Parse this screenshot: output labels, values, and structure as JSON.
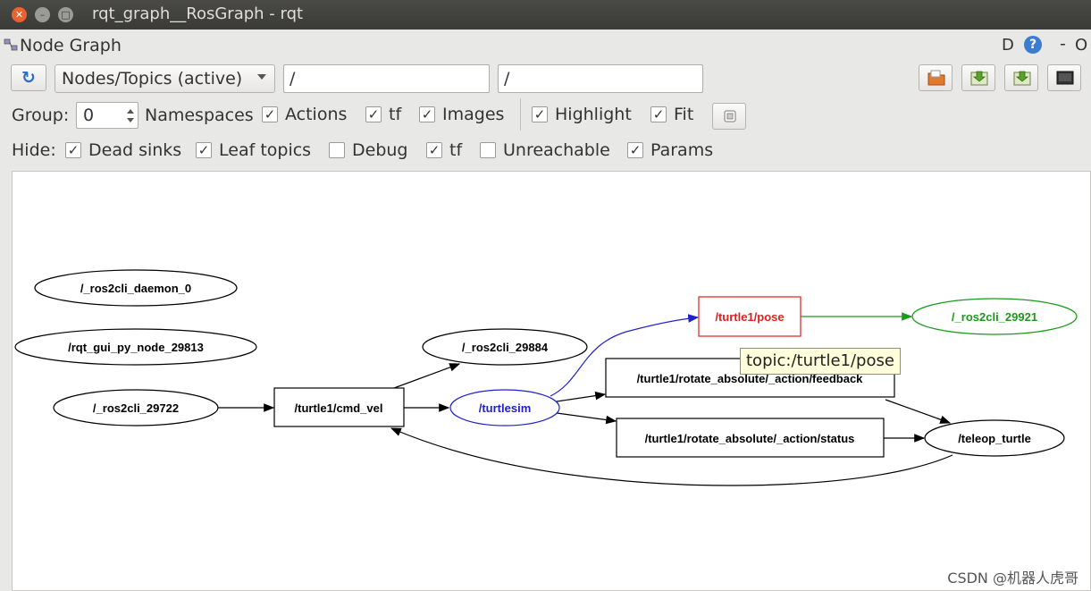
{
  "window": {
    "title": "rqt_graph__RosGraph - rqt"
  },
  "panel": {
    "title": "Node Graph",
    "d_label": "D",
    "help_icon": "?",
    "minimize": "-",
    "close": "O"
  },
  "toolbar": {
    "mode_select": "Nodes/Topics (active)",
    "filter_1": "/",
    "filter_2": "/"
  },
  "row_group": {
    "group_label": "Group:",
    "group_value": "0",
    "namespaces": "Namespaces",
    "actions": "Actions",
    "tf": "tf",
    "images": "Images",
    "highlight": "Highlight",
    "fit": "Fit"
  },
  "row_hide": {
    "hide_label": "Hide:",
    "dead_sinks": "Dead sinks",
    "leaf_topics": "Leaf topics",
    "debug": "Debug",
    "tf": "tf",
    "unreachable": "Unreachable",
    "params": "Params"
  },
  "checkboxes": {
    "actions": true,
    "tf": true,
    "images": true,
    "highlight": true,
    "fit": true,
    "dead_sinks": true,
    "leaf_topics": true,
    "debug": false,
    "hide_tf": true,
    "unreachable": false,
    "params": true
  },
  "graph": {
    "nodes": {
      "daemon": "/_ros2cli_daemon_0",
      "rqt": "/rqt_gui_py_node_29813",
      "cli29722": "/_ros2cli_29722",
      "cmd_vel": "/turtle1/cmd_vel",
      "cli29884": "/_ros2cli_29884",
      "turtlesim": "/turtlesim",
      "pose": "/turtle1/pose",
      "cli29921": "/_ros2cli_29921",
      "feedback": "/turtle1/rotate_absolute/_action/feedback",
      "status": "/turtle1/rotate_absolute/_action/status",
      "teleop": "/teleop_turtle"
    },
    "colors": {
      "highlight_red": "#e02020",
      "highlight_blue": "#2020c8",
      "highlight_green": "#1a9a1a"
    }
  },
  "tooltip": "topic:/turtle1/pose",
  "watermark": "CSDN @机器人虎哥"
}
